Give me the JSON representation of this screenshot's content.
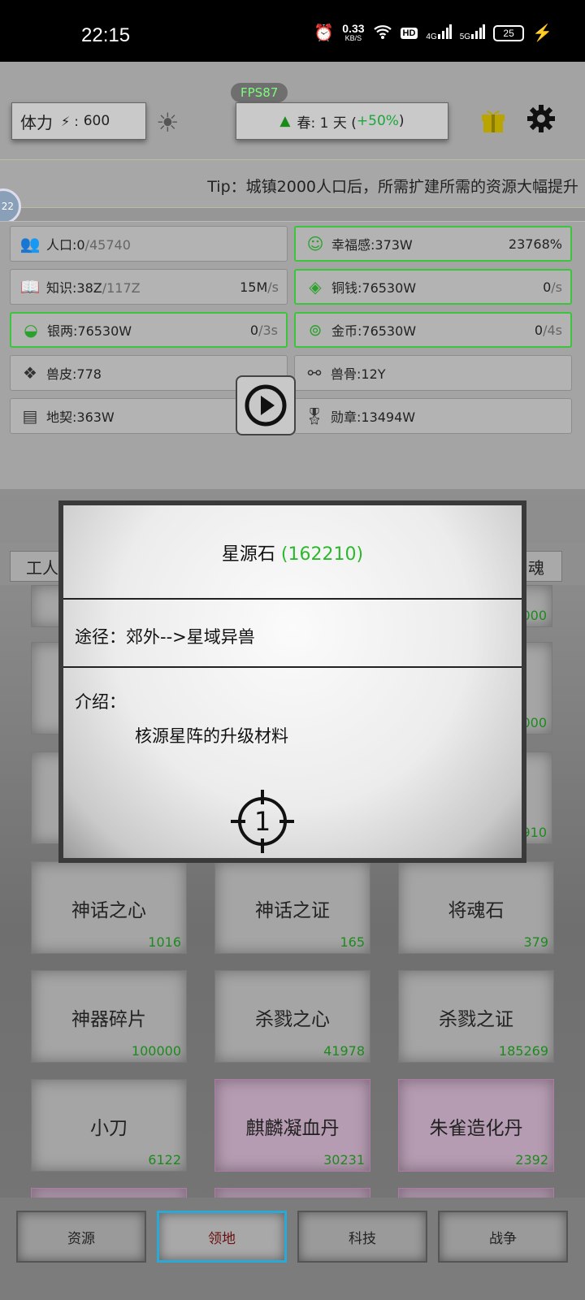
{
  "status_bar": {
    "time": "22:15",
    "speed_value": "0.33",
    "speed_unit": "KB/S",
    "hd_badge": "HD",
    "signal1": "4G",
    "signal2": "5G",
    "battery": "25"
  },
  "top": {
    "stamina_label": "体力",
    "stamina_sep": "⚡ :",
    "stamina_value": "600",
    "fps": "FPS87",
    "season_prefix": "春: 1 天 (",
    "season_bonus": "+50%",
    "season_suffix": ")",
    "tip": "Tip：城镇2000人口后，所需扩建所需的资源大幅提升",
    "side_badge": "22"
  },
  "resources": {
    "population": {
      "label": "人口:0",
      "max": "/45740"
    },
    "happiness": {
      "label": "幸福感:373W",
      "rate": "23768%"
    },
    "knowledge": {
      "label": "知识:38Z",
      "max": "/117Z",
      "rate": "15M",
      "unit": "/s"
    },
    "copper": {
      "label": "铜钱:76530W",
      "rate": "0",
      "unit": "/s"
    },
    "silver": {
      "label": "银两:76530W",
      "rate": "0",
      "unit": "/3s"
    },
    "gold": {
      "label": "金币:76530W",
      "rate": "0",
      "unit": "/4s"
    },
    "hide": {
      "label": "兽皮:778"
    },
    "bone": {
      "label": "兽骨:12Y"
    },
    "deed": {
      "label": "地契:363W"
    },
    "medal": {
      "label": "勋章:13494W"
    }
  },
  "tab_fragments": {
    "left": "工人",
    "right": "魂"
  },
  "partial_counts": [
    "000",
    "000",
    "910"
  ],
  "items": [
    {
      "name": "神话之心",
      "count": "1016"
    },
    {
      "name": "神话之证",
      "count": "165"
    },
    {
      "name": "将魂石",
      "count": "379"
    },
    {
      "name": "神器碎片",
      "count": "100000"
    },
    {
      "name": "杀戮之心",
      "count": "41978"
    },
    {
      "name": "杀戮之证",
      "count": "185269"
    },
    {
      "name": "小刀",
      "count": "6122"
    },
    {
      "name": "麒麟凝血丹",
      "count": "30231"
    },
    {
      "name": "朱雀造化丹",
      "count": "2392"
    }
  ],
  "modal": {
    "title": "星源石",
    "count": "(162210)",
    "route": "途径：郊外-->星域异兽",
    "intro_label": "介绍：",
    "intro_text": "核源星阵的升级材料",
    "target_num": "1"
  },
  "nav": {
    "resources": "资源",
    "territory": "领地",
    "tech": "科技",
    "war": "战争"
  },
  "colors": {
    "accent_green": "#2cb82c",
    "active_nav": "#2aa9d6"
  }
}
